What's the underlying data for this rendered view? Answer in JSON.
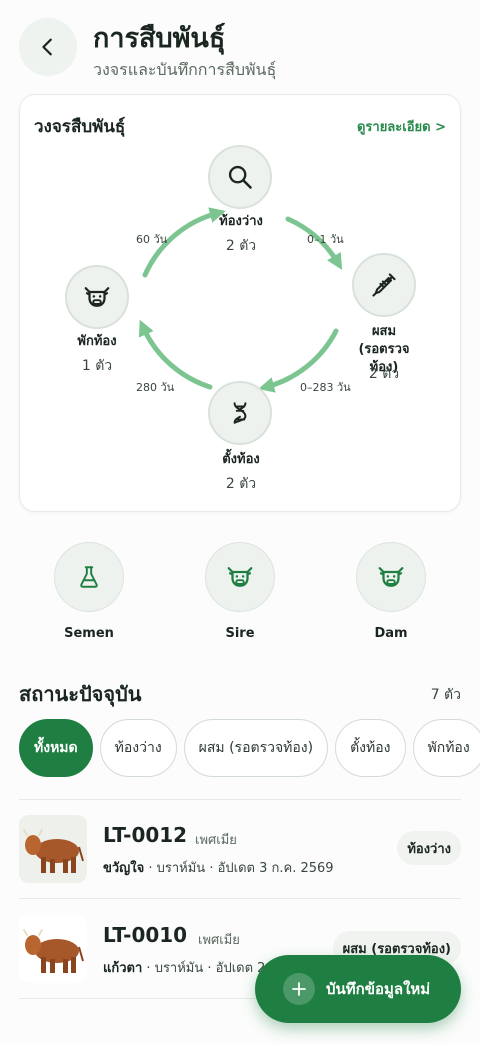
{
  "header": {
    "title": "การสืบพันธุ์",
    "subtitle": "วงจรและบันทึกการสืบพันธุ์"
  },
  "cycle": {
    "title": "วงจรสืบพันธุ์",
    "details_link": "ดูรายละเอียด >",
    "nodes": {
      "empty": {
        "label": "ท้องว่าง",
        "count": "2 ตัว",
        "icon": "search-icon"
      },
      "bred": {
        "label": "ผสม\n(รอตรวจท้อง)",
        "count": "2 ตัว",
        "icon": "syringe-icon"
      },
      "pregnant": {
        "label": "ตั้งท้อง",
        "count": "2 ตัว",
        "icon": "dna-icon"
      },
      "resting": {
        "label": "พักท้อง",
        "count": "1 ตัว",
        "icon": "cow-icon"
      }
    },
    "durations": {
      "empty_to_bred": "0–1 วัน",
      "bred_to_pregnant": "0–283 วัน",
      "pregnant_to_resting": "280 วัน",
      "resting_to_empty": "60 วัน"
    }
  },
  "quick_actions": [
    {
      "label": "Semen",
      "icon": "flask-icon"
    },
    {
      "label": "Sire",
      "icon": "cow-icon"
    },
    {
      "label": "Dam",
      "icon": "cow-icon"
    }
  ],
  "status_section": {
    "title": "สถานะปัจจุบัน",
    "total": "7 ตัว",
    "filters": [
      "ทั้งหมด",
      "ท้องว่าง",
      "ผสม (รอตรวจท้อง)",
      "ตั้งท้อง",
      "พักท้อง"
    ]
  },
  "animals": [
    {
      "id": "LT-0012",
      "sex": "เพศเมีย",
      "name": "ขวัญใจ",
      "meta": " · บราห์มัน · อัปเดต 3 ก.ค. 2569",
      "status": "ท้องว่าง"
    },
    {
      "id": "LT-0010",
      "sex": "เพศเมีย",
      "name": "แก้วตา",
      "meta": " · บราห์มัน · อัปเดต 2",
      "status": "ผสม (รอตรวจท้อง)"
    }
  ],
  "fab": {
    "label": "บันทึกข้อมูลใหม่"
  },
  "colors": {
    "primary": "#1f7f43",
    "arrow": "#7cc590"
  }
}
